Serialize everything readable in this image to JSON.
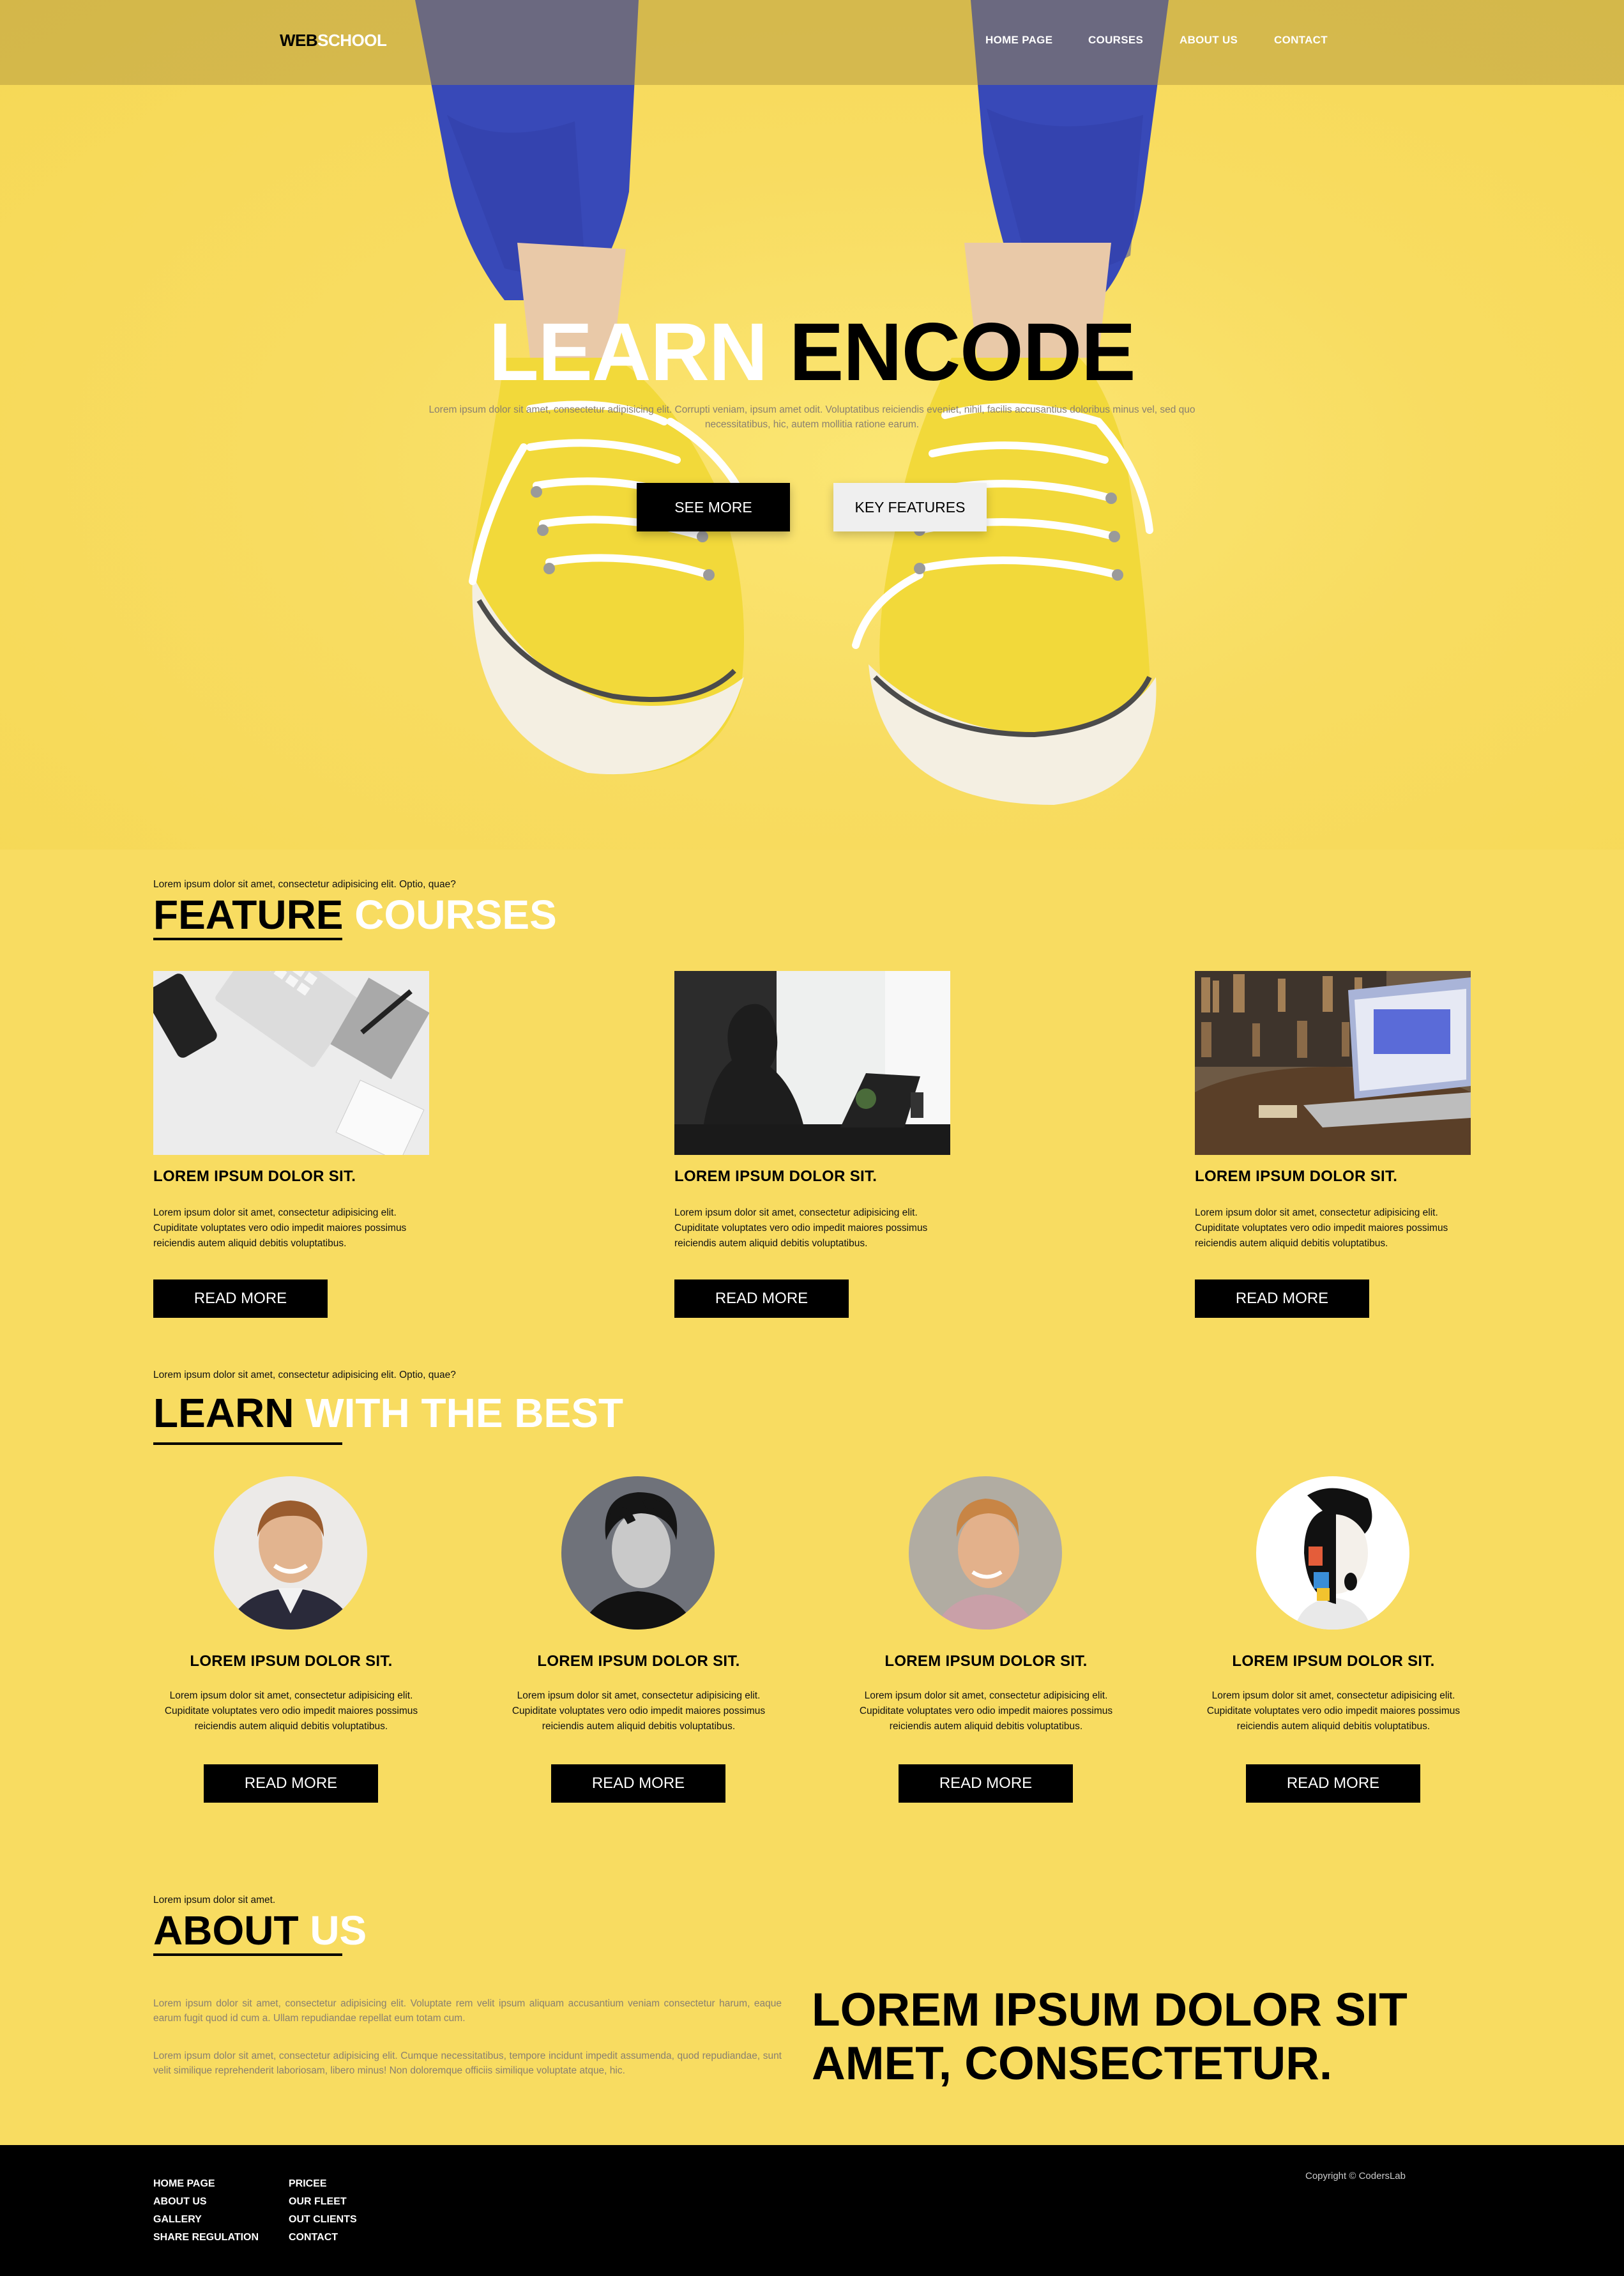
{
  "logo": {
    "part1": "WEB",
    "part2": "SCHOOL"
  },
  "nav": [
    {
      "label": "HOME PAGE"
    },
    {
      "label": "COURSES"
    },
    {
      "label": "ABOUT US"
    },
    {
      "label": "CONTACT"
    }
  ],
  "hero": {
    "title_white": "LEARN",
    "title_black": "ENCODE",
    "subtitle": "Lorem ipsum dolor sit amet, consectetur adipisicing elit. Corrupti veniam, ipsum amet odit. Voluptatibus reiciendis eveniet, nihil, facilis accusantius doloribus minus vel, sed quo necessitatibus, hic, autem mollitia ratione earum.",
    "btn_primary": "SEE MORE",
    "btn_secondary": "KEY FEATURES"
  },
  "features": {
    "kicker": "Lorem ipsum dolor sit amet, consectetur adipisicing elit. Optio, quae?",
    "title_black": "FEATURE",
    "title_white": "COURSES",
    "cards": [
      {
        "title": "LOREM IPSUM DOLOR SIT.",
        "text": "Lorem ipsum dolor sit amet, consectetur adipisicing elit. Cupiditate voluptates vero odio impedit maiores possimus reiciendis autem aliquid debitis voluptatibus.",
        "button": "READ MORE"
      },
      {
        "title": "LOREM IPSUM DOLOR SIT.",
        "text": "Lorem ipsum dolor sit amet, consectetur adipisicing elit. Cupiditate voluptates vero odio impedit maiores possimus reiciendis autem aliquid debitis voluptatibus.",
        "button": "READ MORE"
      },
      {
        "title": "LOREM IPSUM DOLOR SIT.",
        "text": "Lorem ipsum dolor sit amet, consectetur adipisicing elit. Cupiditate voluptates vero odio impedit maiores possimus reiciendis autem aliquid debitis voluptatibus.",
        "button": "READ MORE"
      }
    ]
  },
  "team": {
    "kicker": "Lorem ipsum dolor sit amet, consectetur adipisicing elit. Optio, quae?",
    "title_black": "LEARN",
    "title_white": "WITH THE BEST",
    "members": [
      {
        "title": "LOREM IPSUM DOLOR SIT.",
        "text": "Lorem ipsum dolor sit amet, consectetur adipisicing elit. Cupiditate voluptates vero odio impedit maiores possimus reiciendis autem aliquid debitis voluptatibus.",
        "button": "READ MORE"
      },
      {
        "title": "LOREM IPSUM DOLOR SIT.",
        "text": "Lorem ipsum dolor sit amet, consectetur adipisicing elit. Cupiditate voluptates vero odio impedit maiores possimus reiciendis autem aliquid debitis voluptatibus.",
        "button": "READ MORE"
      },
      {
        "title": "LOREM IPSUM DOLOR SIT.",
        "text": "Lorem ipsum dolor sit amet, consectetur adipisicing elit. Cupiditate voluptates vero odio impedit maiores possimus reiciendis autem aliquid debitis voluptatibus.",
        "button": "READ MORE"
      },
      {
        "title": "LOREM IPSUM DOLOR SIT.",
        "text": "Lorem ipsum dolor sit amet, consectetur adipisicing elit. Cupiditate voluptates vero odio impedit maiores possimus reiciendis autem aliquid debitis voluptatibus.",
        "button": "READ MORE"
      }
    ]
  },
  "about": {
    "kicker": "Lorem ipsum dolor sit amet.",
    "title_black": "ABOUT",
    "title_white": "US",
    "para1": "Lorem ipsum dolor sit amet, consectetur adipisicing elit. Voluptate rem velit ipsum aliquam accusantium veniam consectetur harum, eaque earum fugit quod id cum a. Ullam repudiandae repellat eum totam cum.",
    "para2": "Lorem ipsum dolor sit amet, consectetur adipisicing elit. Cumque necessitatibus, tempore incidunt impedit assumenda, quod repudiandae, sunt velit similique reprehenderit laboriosam, libero minus! Non doloremque officiis similique voluptate atque, hic.",
    "big_line1": "LOREM IPSUM DOLOR SIT",
    "big_line2": "AMET, CONSECTETUR."
  },
  "footer": {
    "col1": [
      "HOME PAGE",
      "ABOUT US",
      "GALLERY",
      "SHARE REGULATION"
    ],
    "col2": [
      "PRICEE",
      "OUR FLEET",
      "OUT CLIENTS",
      "CONTACT"
    ],
    "copyright": "Copyright © CodersLab"
  },
  "colors": {
    "background": "#f8dc61",
    "accent_dark": "#000000",
    "accent_light": "#ffffff",
    "muted_text": "#8a8070"
  }
}
